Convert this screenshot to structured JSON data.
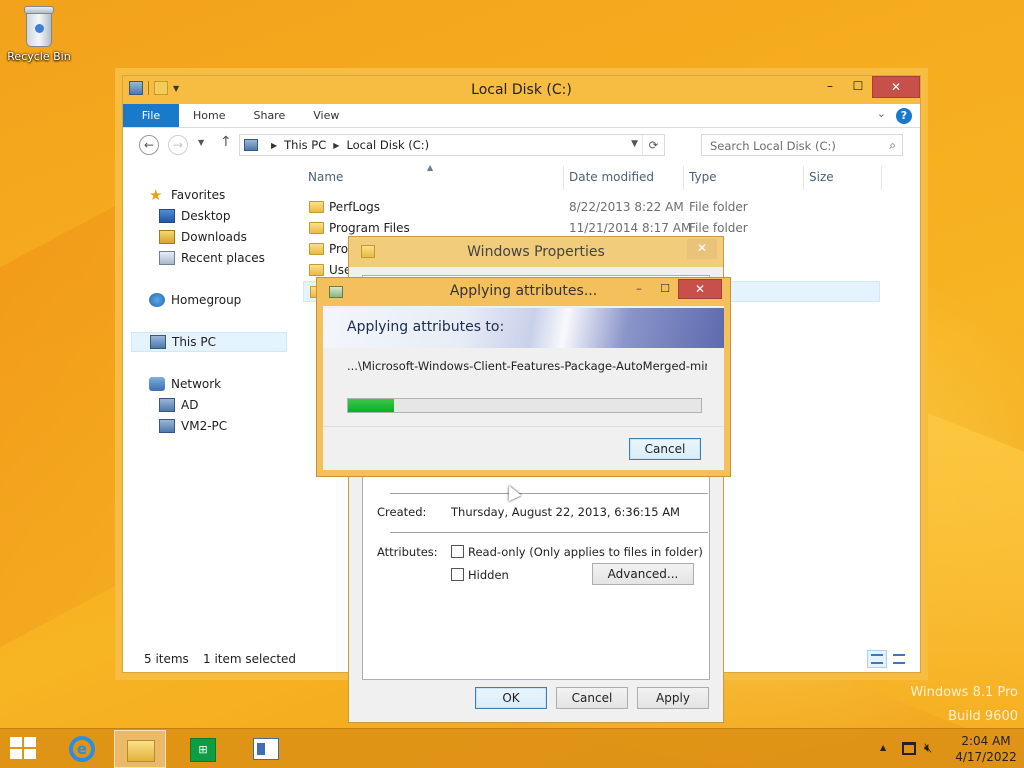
{
  "desktop": {
    "recycle_bin_label": "Recycle Bin",
    "watermark": [
      "Windows 8.1 Pro",
      "Build 9600"
    ]
  },
  "explorer": {
    "title": "Local Disk (C:)",
    "window_buttons": {
      "minimize": "–",
      "maximize": "☐",
      "close": "✕"
    },
    "ribbon_tabs": [
      "File",
      "Home",
      "Share",
      "View"
    ],
    "breadcrumb": [
      "This PC",
      "Local Disk (C:)"
    ],
    "search_placeholder": "Search Local Disk (C:)",
    "nav": {
      "favorites": "Favorites",
      "desktop": "Desktop",
      "downloads": "Downloads",
      "recent": "Recent places",
      "homegroup": "Homegroup",
      "this_pc": "This PC",
      "network": "Network",
      "ad": "AD",
      "vm2": "VM2-PC"
    },
    "columns": {
      "name": "Name",
      "date": "Date modified",
      "type": "Type",
      "size": "Size"
    },
    "files": [
      {
        "name": "PerfLogs",
        "date": "8/22/2013 8:22 AM",
        "type": "File folder"
      },
      {
        "name": "Program Files",
        "date": "11/21/2014 8:17 AM",
        "type": "File folder"
      },
      {
        "name": "Proc",
        "date": "",
        "type": ""
      },
      {
        "name": "Use",
        "date": "",
        "type": ""
      }
    ],
    "status": {
      "items": "5 items",
      "selected": "1 item selected"
    }
  },
  "properties": {
    "title": "Windows Properties",
    "created_label": "Created:",
    "created_value": "Thursday, August 22, 2013, 6:36:15 AM",
    "attributes_label": "Attributes:",
    "readonly_label": "Read-only (Only applies to files in folder)",
    "hidden_label": "Hidden",
    "advanced_label": "Advanced...",
    "ok": "OK",
    "cancel": "Cancel",
    "apply": "Apply",
    "readonly_checked": false,
    "hidden_checked": false
  },
  "apply_dialog": {
    "title": "Applying attributes...",
    "heading": "Applying attributes to:",
    "path": "...\\Microsoft-Windows-Client-Features-Package-AutoMerged-mink",
    "progress_fraction": 0.13,
    "cancel": "Cancel",
    "progress_color": "#06b025"
  },
  "taskbar": {
    "time": "2:04 AM",
    "date": "4/17/2022",
    "store_label": "Store"
  },
  "colors": {
    "accent": "#1979ca",
    "window_frame": "#f7bd42",
    "close_button": "#c7504a"
  }
}
